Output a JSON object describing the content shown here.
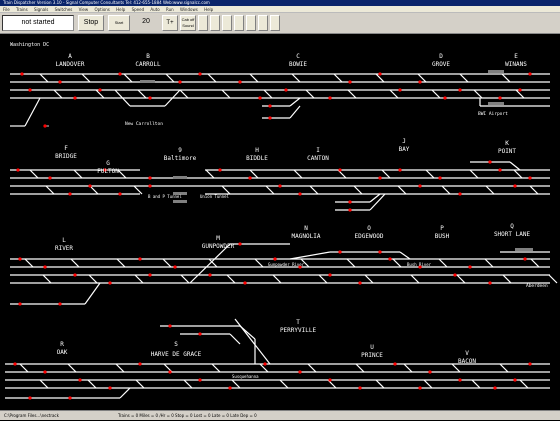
{
  "window": {
    "title": "Train Dispatcher Version 3.10 - Signal Computer Consultants   Tel: 412-655-1884   Web:www.signalcc.com"
  },
  "menu": [
    "File",
    "Trains",
    "Signals",
    "Switches",
    "View",
    "Options",
    "Help",
    "Speed",
    "Auto",
    "Run",
    "Windows",
    "Help"
  ],
  "toolbar": {
    "status": "not started",
    "stop_label": "Stop",
    "start_label": "Start",
    "speed_value": "20",
    "time_label": "T+",
    "cab_label": "Cab off Sound"
  },
  "territory": {
    "label": "Washington DC"
  },
  "stations_row1": [
    {
      "letter": "A",
      "name": "LANDOVER"
    },
    {
      "letter": "B",
      "name": "CARROLL"
    },
    {
      "letter": "C",
      "name": "BOWIE"
    },
    {
      "letter": "D",
      "name": "GROVE"
    },
    {
      "letter": "E",
      "name": "WINANS"
    }
  ],
  "stations_row2": [
    {
      "letter": "F",
      "name": "BRIDGE"
    },
    {
      "letter": "G",
      "name": "FULTON"
    },
    {
      "letter": "9",
      "name": "Baltimore"
    },
    {
      "letter": "H",
      "name": "BIDDLE"
    },
    {
      "letter": "I",
      "name": "CANTON"
    },
    {
      "letter": "J",
      "name": "BAY"
    },
    {
      "letter": "K",
      "name": "POINT"
    }
  ],
  "stations_row3": [
    {
      "letter": "L",
      "name": "RIVER"
    },
    {
      "letter": "M",
      "name": "GUNPOWDER"
    },
    {
      "letter": "N",
      "name": "MAGNOLIA"
    },
    {
      "letter": "O",
      "name": "EDGEWOOD"
    },
    {
      "letter": "P",
      "name": "BUSH"
    },
    {
      "letter": "Q",
      "name": "SHORT LANE"
    }
  ],
  "stations_row4": [
    {
      "letter": "R",
      "name": "OAK"
    },
    {
      "letter": "S",
      "name": "HARVE DE GRACE"
    },
    {
      "letter": "T",
      "name": "PERRYVILLE"
    },
    {
      "letter": "U",
      "name": "PRINCE"
    },
    {
      "letter": "V",
      "name": "BACON"
    }
  ],
  "places": {
    "new_carrollton": "New Carrollton",
    "bwi": "BWI Airport",
    "tunnel": "B and P Tunnel",
    "union_tunnel": "Union Tunnel",
    "gunpowder_river": "Gunpowder River",
    "bush_river": "Bush River",
    "aberdeen": "Aberdeen",
    "susquehanna": "Susquehanna"
  },
  "status_bar": {
    "file": "C:\\Program Files...\\nectrack",
    "stats": "Trains = 0  Miles = 0  /Hr = 0  Stop = 0  Lost = 0  Late = 0  Late Dep = 0"
  },
  "colors": {
    "track": "#ffffff",
    "signal": "#ff0000",
    "label": "#ffffff",
    "platform": "#808080",
    "background": "#000000"
  }
}
